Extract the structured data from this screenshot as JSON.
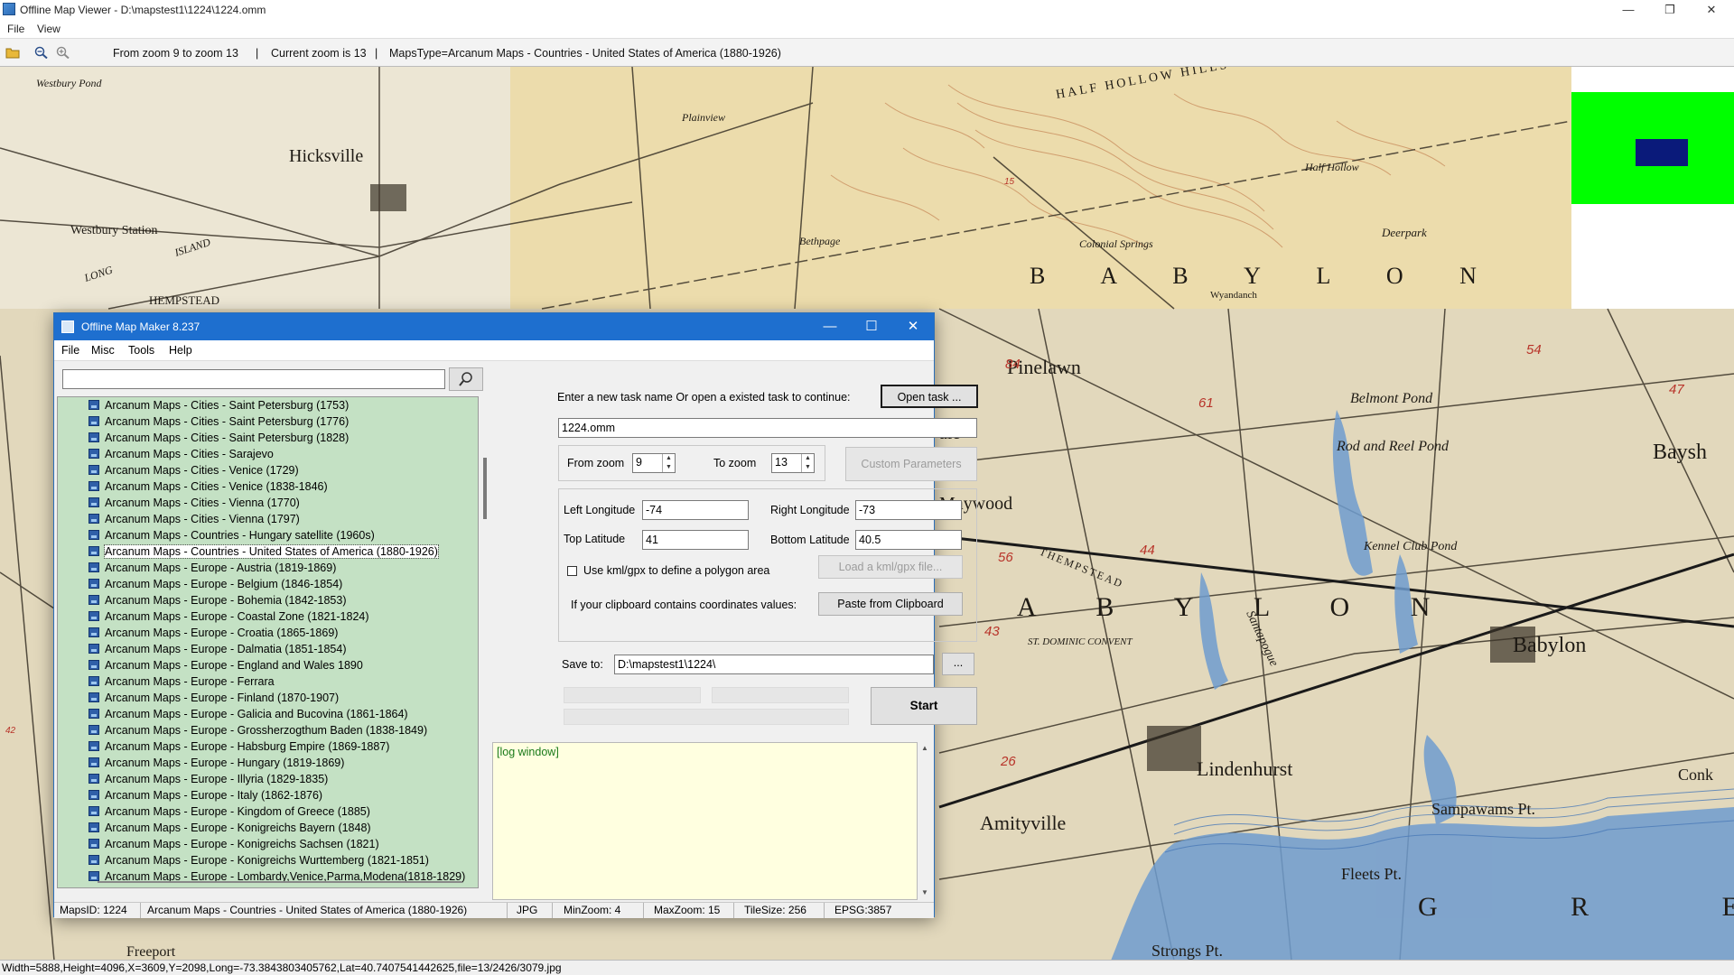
{
  "viewer": {
    "title": "Offline Map Viewer - D:\\mapstest1\\1224\\1224.omm",
    "menu": [
      "File",
      "View"
    ],
    "toolbar": {
      "zoom_range": "From zoom 9 to zoom 13",
      "current_zoom": "Current zoom is 13",
      "maps_type": "MapsType=Arcanum Maps - Countries - United States of America (1880-1926)"
    },
    "status": "Width=5888,Height=4096,X=3609,Y=2098,Long=-73.3843803405762,Lat=40.7407541442625,file=13/2426/3079.jpg",
    "window_controls": {
      "minimize": "—",
      "restore": "❐",
      "close": "✕"
    }
  },
  "map_labels": {
    "westbury_pond": "Westbury Pond",
    "hicksville": "Hicksville",
    "westbury_station": "Westbury Station",
    "long": "LONG",
    "island": "ISLAND",
    "hempstead": "HEMPSTEAD",
    "plainview": "Plainview",
    "bethpage": "Bethpage",
    "half_hollow_hills": "HALF HOLLOW HILLS",
    "half_hollow": "Half Hollow",
    "colonial_springs": "Colonial Springs",
    "deerpark": "Deerpark",
    "wyandanch": "Wyandanch",
    "babylon_upper": "B A B Y L O N",
    "pinelawn": "Pinelawn",
    "belmont_pond": "Belmont Pond",
    "rod_and_reel_pond": "Rod and Reel Pond",
    "kennel_club_pond": "Kennel Club Pond",
    "maywood": "Maywood",
    "ale": "ale",
    "baysh": "Baysh",
    "thempstead": "THEMPSTEAD",
    "santapogue": "Santapogue",
    "st_dominic_convent": "ST. DOMINIC CONVENT",
    "babylon_lower": "B A B Y L O N",
    "babylon_town": "Babylon",
    "lindenhurst": "Lindenhurst",
    "amityville": "Amityville",
    "sampawams_pt": "Sampawams Pt.",
    "fleets_pt": "Fleets Pt.",
    "strongs_pt": "Strongs Pt.",
    "conk": "Conk",
    "freeport": "Freeport",
    "gre": "G R E",
    "n84": "84",
    "n61": "61",
    "n54": "54",
    "n47": "47",
    "n44": "44",
    "n56": "56",
    "n43": "43",
    "n26": "26",
    "n15": "15",
    "n42": "42"
  },
  "dialog": {
    "title": "Offline Map Maker 8.237",
    "menu": [
      "File",
      "Misc",
      "Tools",
      "Help"
    ],
    "search_value": "",
    "maps_list": [
      "Arcanum Maps - Cities - Saint Petersburg (1753)",
      "Arcanum Maps - Cities - Saint Petersburg (1776)",
      "Arcanum Maps - Cities - Saint Petersburg (1828)",
      "Arcanum Maps - Cities - Sarajevo",
      "Arcanum Maps - Cities - Venice (1729)",
      "Arcanum Maps - Cities - Venice (1838-1846)",
      "Arcanum Maps - Cities - Vienna (1770)",
      "Arcanum Maps - Cities - Vienna (1797)",
      "Arcanum Maps - Countries - Hungary satellite (1960s)",
      "Arcanum Maps - Countries - United States of America (1880-1926)",
      "Arcanum Maps - Europe - Austria (1819-1869)",
      "Arcanum Maps - Europe - Belgium (1846-1854)",
      "Arcanum Maps - Europe - Bohemia (1842-1853)",
      "Arcanum Maps - Europe - Coastal Zone (1821-1824)",
      "Arcanum Maps - Europe - Croatia (1865-1869)",
      "Arcanum Maps - Europe - Dalmatia (1851-1854)",
      "Arcanum Maps - Europe - England and Wales 1890",
      "Arcanum Maps - Europe - Ferrara",
      "Arcanum Maps - Europe - Finland (1870-1907)",
      "Arcanum Maps - Europe - Galicia and Bucovina (1861-1864)",
      "Arcanum Maps - Europe - Grossherzogthum Baden (1838-1849)",
      "Arcanum Maps - Europe - Habsburg Empire (1869-1887)",
      "Arcanum Maps - Europe - Hungary (1819-1869)",
      "Arcanum Maps - Europe - Illyria (1829-1835)",
      "Arcanum Maps - Europe - Italy (1862-1876)",
      "Arcanum Maps - Europe - Kingdom of Greece (1885)",
      "Arcanum Maps - Europe - Konigreichs Bayern (1848)",
      "Arcanum Maps - Europe - Konigreichs Sachsen (1821)",
      "Arcanum Maps - Europe - Konigreichs Wurttemberg (1821-1851)",
      "Arcanum Maps - Europe - Lombardy,Venice,Parma,Modena(1818-1829)"
    ],
    "selected_index": 9,
    "task_prompt": "Enter a new task name Or open a existed task to continue:",
    "open_task_label": "Open task ...",
    "task_name": "1224.omm",
    "from_zoom_label": "From zoom",
    "from_zoom": "9",
    "to_zoom_label": "To zoom",
    "to_zoom": "13",
    "custom_params_label": "Custom Parameters",
    "left_lon_label": "Left Longitude",
    "left_lon": "-74",
    "right_lon_label": "Right Longitude",
    "right_lon": "-73",
    "top_lat_label": "Top Latitude",
    "top_lat": "41",
    "bottom_lat_label": "Bottom Latitude",
    "bottom_lat": "40.5",
    "kml_label": "Use kml/gpx to define a polygon area",
    "load_kml_label": "Load a kml/gpx file...",
    "clipboard_label": "If your clipboard contains coordinates values:",
    "paste_label": "Paste from Clipboard",
    "save_to_label": "Save to:",
    "save_to": "D:\\mapstest1\\1224\\",
    "browse_label": "...",
    "start_label": "Start",
    "log_text": "[log window]",
    "status": {
      "maps_id": "MapsID: 1224",
      "maps_name": "Arcanum Maps - Countries - United States of America (1880-1926)",
      "format": "JPG",
      "min_zoom": "MinZoom: 4",
      "max_zoom": "MaxZoom: 15",
      "tile_size": "TileSize: 256",
      "epsg": "EPSG:3857"
    }
  },
  "colors": {
    "map_paper": "#e8dcc0",
    "map_lower": "#e4d9bd",
    "water": "#6f9ccf",
    "dialog_titlebar": "#1e6fcf",
    "list_bg": "#c4e1c4",
    "log_bg": "#ffffe0",
    "contour": "#c78a5a",
    "green_tile": "#00ff00",
    "navy_tile": "#0a1a7a"
  }
}
